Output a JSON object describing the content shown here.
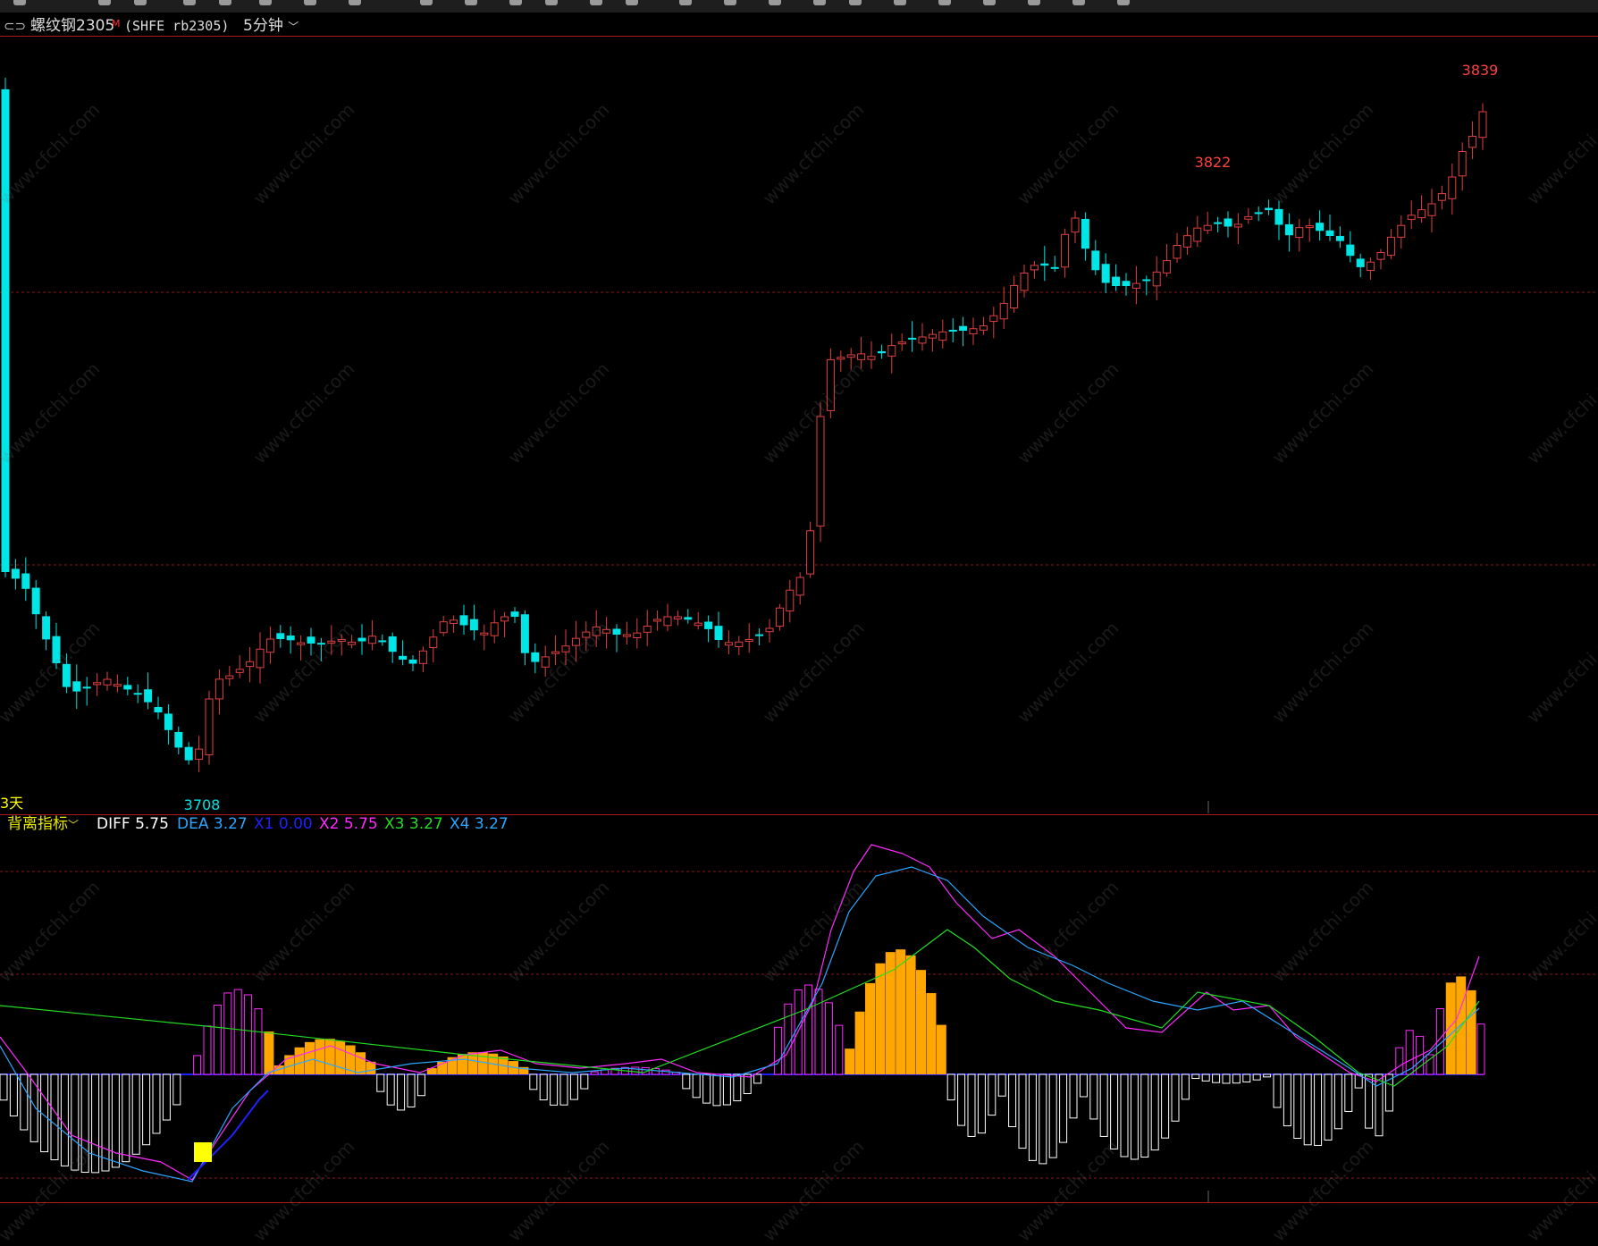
{
  "header": {
    "symbol_name": "螺纹钢2305",
    "main_flag": "M",
    "contract": "(SHFE rb2305)",
    "period": "5分钟"
  },
  "price_panel": {
    "high_label": "3839",
    "mid_high_label": "3822",
    "low_label": "3708",
    "days_label": "3天"
  },
  "indicator_panel": {
    "name": "背离指标",
    "diff_label": "DIFF",
    "diff_value": "5.75",
    "dea_label": "DEA",
    "dea_value": "3.27",
    "x1_label": "X1",
    "x1_value": "0.00",
    "x2_label": "X2",
    "x2_value": "5.75",
    "x3_label": "X3",
    "x3_value": "3.27",
    "x4_label": "X4",
    "x4_value": "3.27"
  },
  "watermark_text": "www.cfchi.com",
  "colors": {
    "up": "#e04040",
    "down": "#00e5e5",
    "background": "#000000",
    "separator": "#b01818",
    "diff": "#ffffff",
    "dea": "#2aa6ff",
    "x1": "#2020ff",
    "x2": "#ff2aff",
    "x3": "#22dd22",
    "x4": "#2aa6ff",
    "orange_bar": "#ffa600",
    "label_text": "#ffff00"
  }
}
